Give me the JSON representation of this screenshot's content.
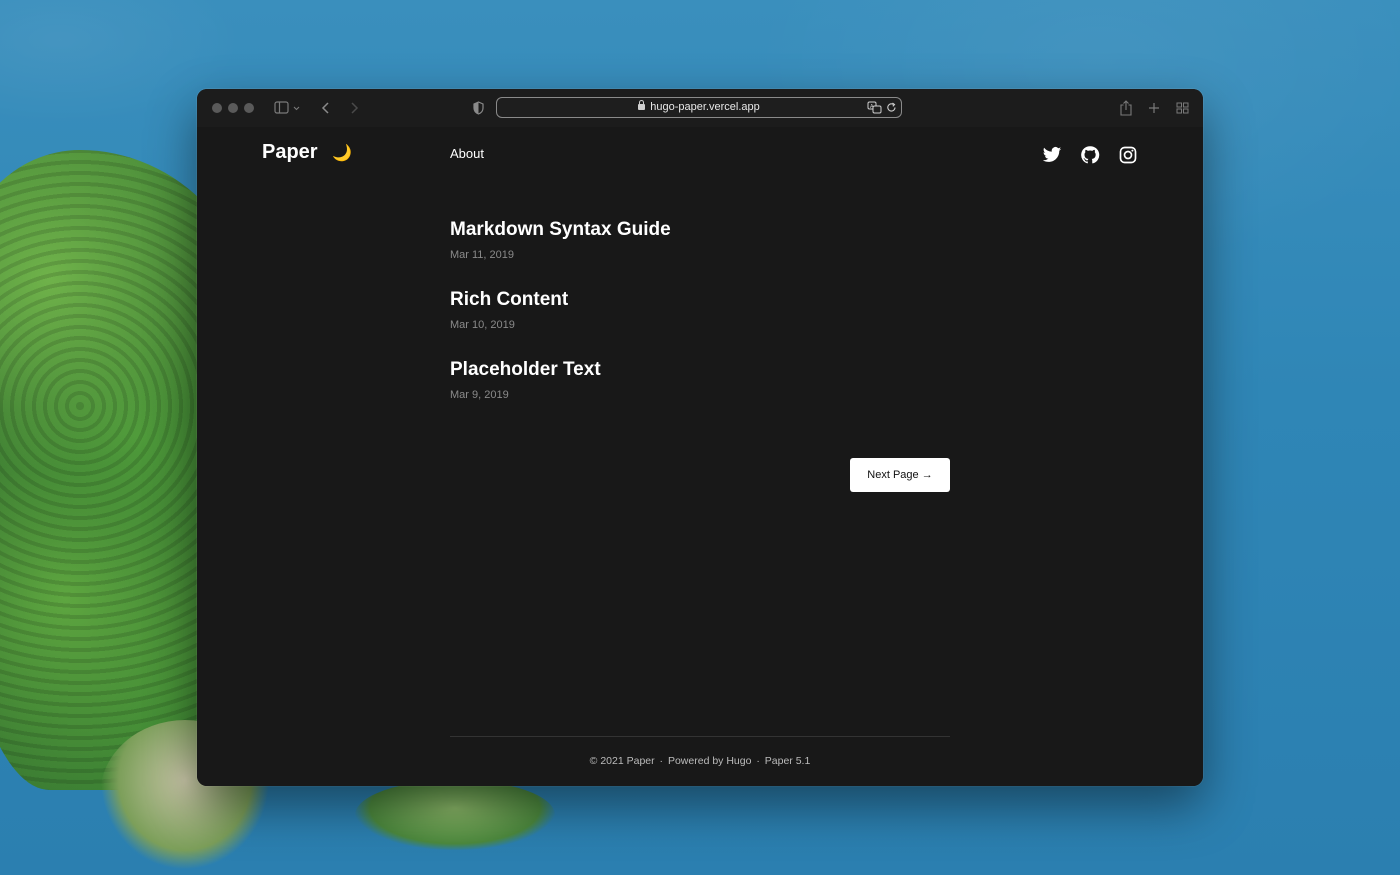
{
  "browser": {
    "url": "hugo-paper.vercel.app"
  },
  "site": {
    "logo": "Paper",
    "theme_toggle": "🌙",
    "nav": [
      "About"
    ]
  },
  "posts": [
    {
      "title": "Markdown Syntax Guide",
      "date": "Mar 11, 2019"
    },
    {
      "title": "Rich Content",
      "date": "Mar 10, 2019"
    },
    {
      "title": "Placeholder Text",
      "date": "Mar 9, 2019"
    }
  ],
  "pagination": {
    "next_label": "Next Page →"
  },
  "footer": {
    "copyright": "© 2021 Paper",
    "sep1": "·",
    "powered": "Powered by Hugo",
    "sep2": "·",
    "theme": "Paper 5.1"
  },
  "icons": {
    "social": [
      "twitter-icon",
      "github-icon",
      "instagram-icon"
    ]
  }
}
